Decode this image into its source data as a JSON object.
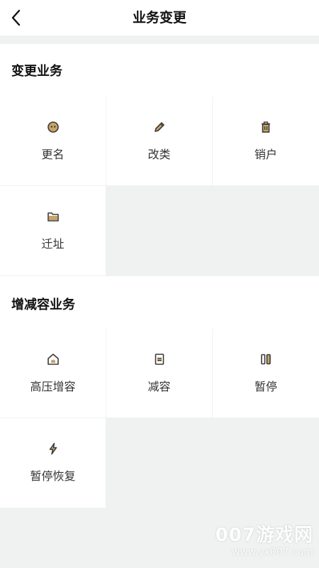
{
  "header": {
    "title": "业务变更",
    "back_icon": "chevron-left-icon"
  },
  "sections": [
    {
      "title": "变更业务",
      "items": [
        {
          "label": "更名",
          "icon": "face-icon"
        },
        {
          "label": "改类",
          "icon": "pencil-icon"
        },
        {
          "label": "销户",
          "icon": "trash-icon"
        },
        {
          "label": "迁址",
          "icon": "folder-icon"
        }
      ]
    },
    {
      "title": "增减容业务",
      "items": [
        {
          "label": "高压增容",
          "icon": "house-icon"
        },
        {
          "label": "减容",
          "icon": "document-icon"
        },
        {
          "label": "暂停",
          "icon": "pause-icon"
        },
        {
          "label": "暂停恢复",
          "icon": "lightning-icon"
        }
      ]
    }
  ],
  "watermark": {
    "line1": "007游戏网",
    "line2": "www.yx007.com"
  },
  "colors": {
    "background": "#f0f2f2",
    "icon": "#3a3a3a",
    "icon_accent": "#c9a466"
  }
}
